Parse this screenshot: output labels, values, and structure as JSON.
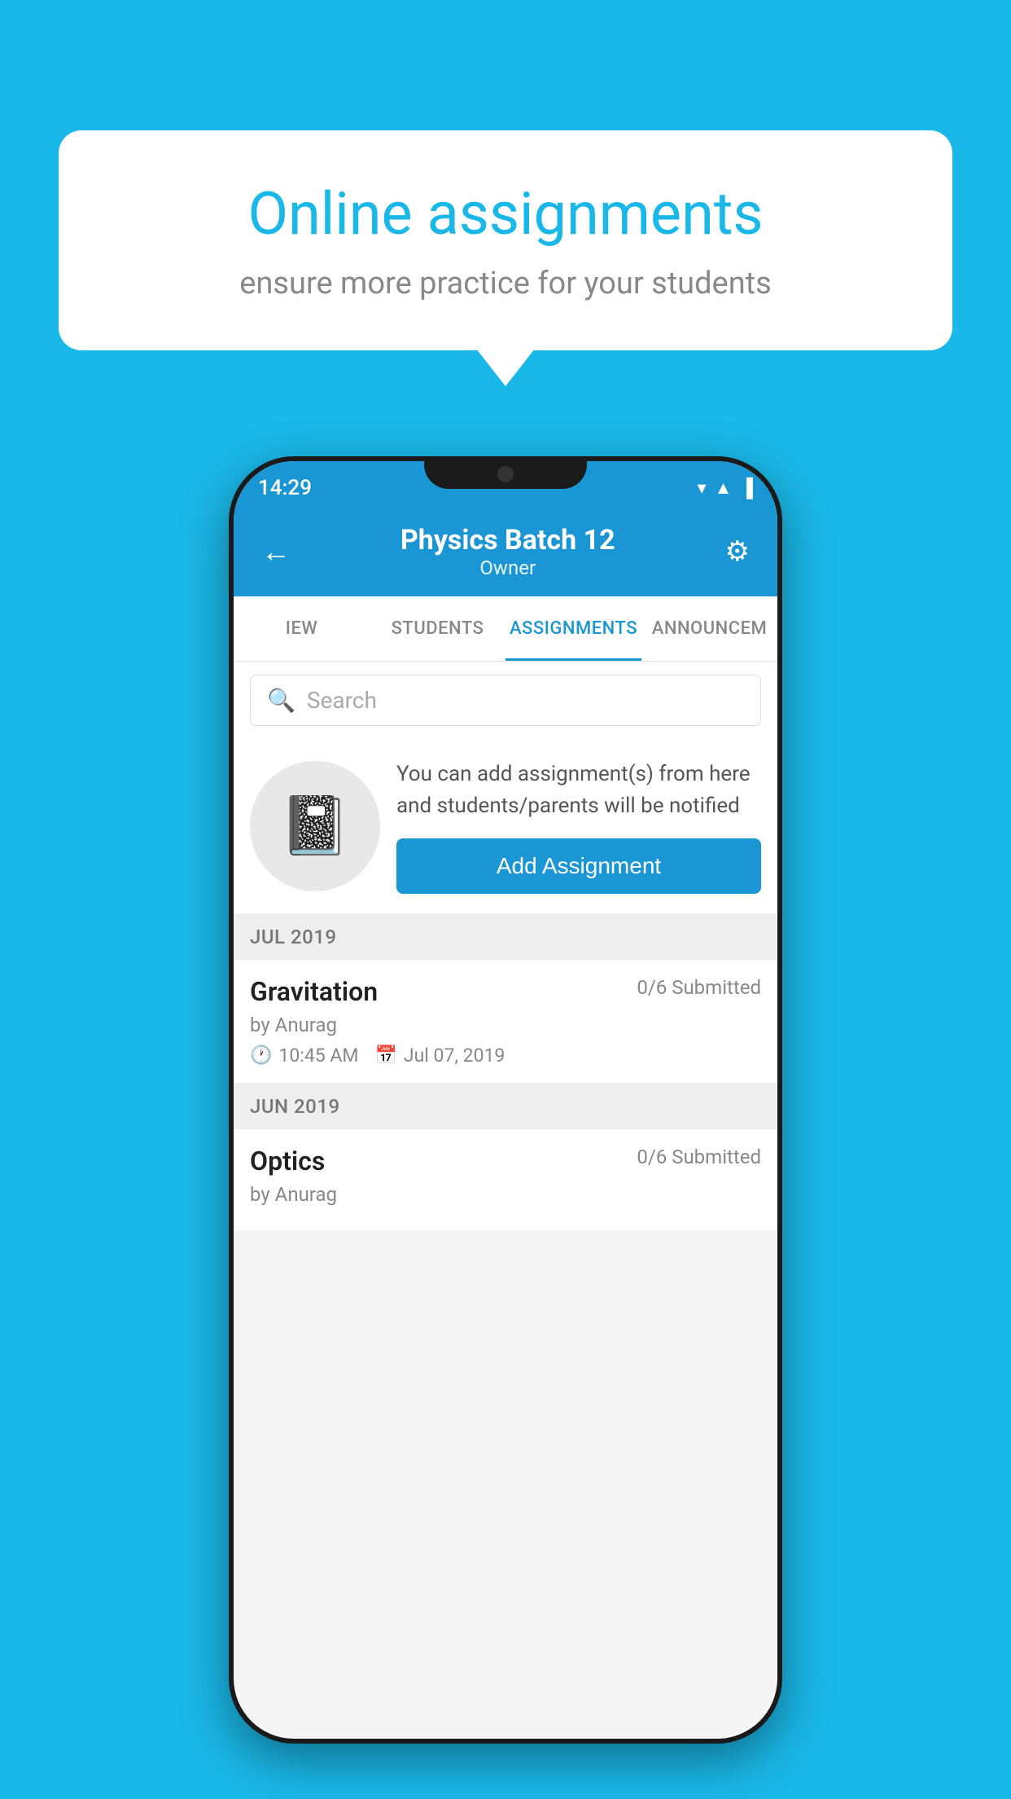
{
  "background_color": "#1ab8e8",
  "speech_bubble": {
    "title": "Online assignments",
    "subtitle": "ensure more practice for your students"
  },
  "phone": {
    "status_bar": {
      "time": "14:29",
      "icons": [
        "wifi",
        "signal",
        "battery"
      ]
    },
    "app_bar": {
      "title": "Physics Batch 12",
      "subtitle": "Owner",
      "back_label": "←",
      "settings_label": "⚙"
    },
    "tabs": [
      {
        "label": "IEW",
        "active": false
      },
      {
        "label": "STUDENTS",
        "active": false
      },
      {
        "label": "ASSIGNMENTS",
        "active": true
      },
      {
        "label": "ANNOUNCEM",
        "active": false
      }
    ],
    "search": {
      "placeholder": "Search"
    },
    "promo": {
      "text": "You can add assignment(s) from here and students/parents will be notified",
      "button_label": "Add Assignment"
    },
    "sections": [
      {
        "month": "JUL 2019",
        "assignments": [
          {
            "name": "Gravitation",
            "submitted": "0/6 Submitted",
            "by": "by Anurag",
            "time": "10:45 AM",
            "date": "Jul 07, 2019"
          }
        ]
      },
      {
        "month": "JUN 2019",
        "assignments": [
          {
            "name": "Optics",
            "submitted": "0/6 Submitted",
            "by": "by Anurag",
            "time": "",
            "date": ""
          }
        ]
      }
    ]
  }
}
